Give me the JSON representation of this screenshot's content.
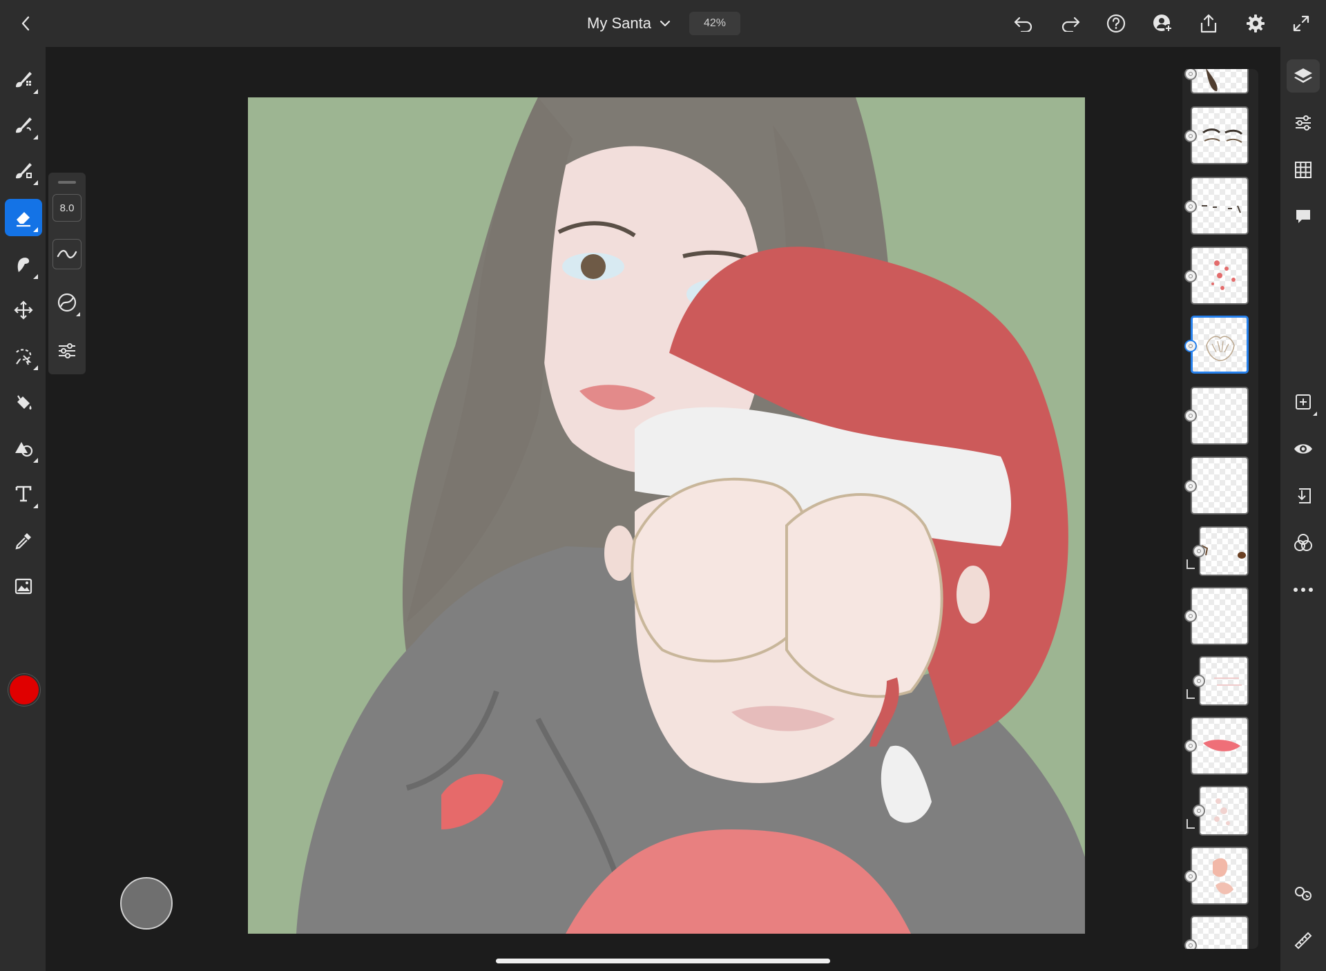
{
  "header": {
    "back_icon": "chevron-left-icon",
    "document_title": "My Santa",
    "title_menu_icon": "chevron-down-icon",
    "zoom_level": "42%",
    "actions": [
      "undo-icon",
      "redo-icon",
      "help-icon",
      "invite-user-icon",
      "share-icon",
      "settings-icon",
      "fullscreen-icon"
    ]
  },
  "toolbar": {
    "tools": [
      "pixel-brush",
      "live-brush",
      "vector-brush",
      "eraser",
      "smudge",
      "transform",
      "selection",
      "fill",
      "shapes",
      "text",
      "eyedropper",
      "image"
    ],
    "active_tool": "eraser",
    "current_color": "#e00000"
  },
  "brush_settings": {
    "size": "8.0",
    "buttons": [
      "brush-shape-icon",
      "pressure-icon",
      "brush-settings-icon"
    ]
  },
  "canvas": {
    "background_color": "#9db592",
    "artwork": "woman covering child's eyes, child in santa hat"
  },
  "layers": {
    "selected_index": 4,
    "count_visible": 14
  },
  "right_rail": {
    "top": [
      "layers-icon",
      "properties-icon",
      "grid-icon",
      "comments-icon"
    ],
    "middle": [
      "add-layer-icon",
      "visibility-icon",
      "import-icon",
      "blend-modes-icon",
      "more-icon"
    ],
    "bottom": [
      "touch-shortcut-icon",
      "ruler-icon"
    ]
  },
  "colors": {
    "accent": "#1473e6",
    "panel": "#2d2d2d",
    "workspace": "#1c1c1c"
  }
}
